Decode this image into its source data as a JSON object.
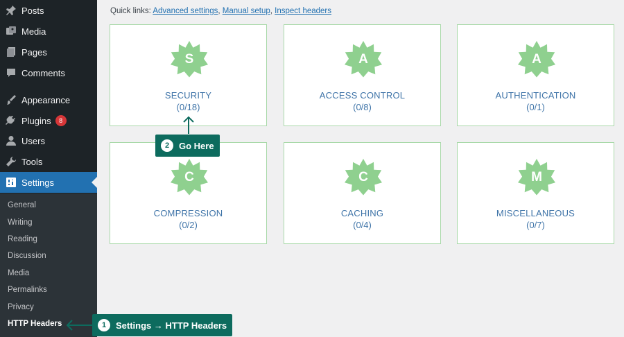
{
  "sidebar": {
    "menu": [
      {
        "label": "Posts",
        "icon": "pin-icon"
      },
      {
        "label": "Media",
        "icon": "media-icon"
      },
      {
        "label": "Pages",
        "icon": "pages-icon"
      },
      {
        "label": "Comments",
        "icon": "comment-icon"
      },
      {
        "label": "Appearance",
        "icon": "brush-icon"
      },
      {
        "label": "Plugins",
        "icon": "plug-icon",
        "badge": "8"
      },
      {
        "label": "Users",
        "icon": "user-icon"
      },
      {
        "label": "Tools",
        "icon": "wrench-icon"
      },
      {
        "label": "Settings",
        "icon": "settings-icon",
        "active": true
      }
    ],
    "submenu": [
      "General",
      "Writing",
      "Reading",
      "Discussion",
      "Media",
      "Permalinks",
      "Privacy",
      "HTTP Headers"
    ]
  },
  "quick_links": {
    "prefix": "Quick links:",
    "links": [
      "Advanced settings",
      "Manual setup",
      "Inspect headers"
    ]
  },
  "cards": [
    {
      "letter": "S",
      "title": "SECURITY",
      "count": "(0/18)"
    },
    {
      "letter": "A",
      "title": "ACCESS CONTROL",
      "count": "(0/8)"
    },
    {
      "letter": "A",
      "title": "AUTHENTICATION",
      "count": "(0/1)"
    },
    {
      "letter": "C",
      "title": "COMPRESSION",
      "count": "(0/2)"
    },
    {
      "letter": "C",
      "title": "CACHING",
      "count": "(0/4)"
    },
    {
      "letter": "M",
      "title": "MISCELLANEOUS",
      "count": "(0/7)"
    }
  ],
  "callouts": [
    {
      "num": "1",
      "text": "Settings → HTTP Headers"
    },
    {
      "num": "2",
      "text": "Go Here"
    }
  ],
  "colors": {
    "sidebar_bg": "#1d2327",
    "active_bg": "#2271b1",
    "star_green": "#8fd08f",
    "card_border": "#a9d9a9",
    "callout_bg": "#0d6b5e",
    "title_blue": "#3f74a8"
  }
}
